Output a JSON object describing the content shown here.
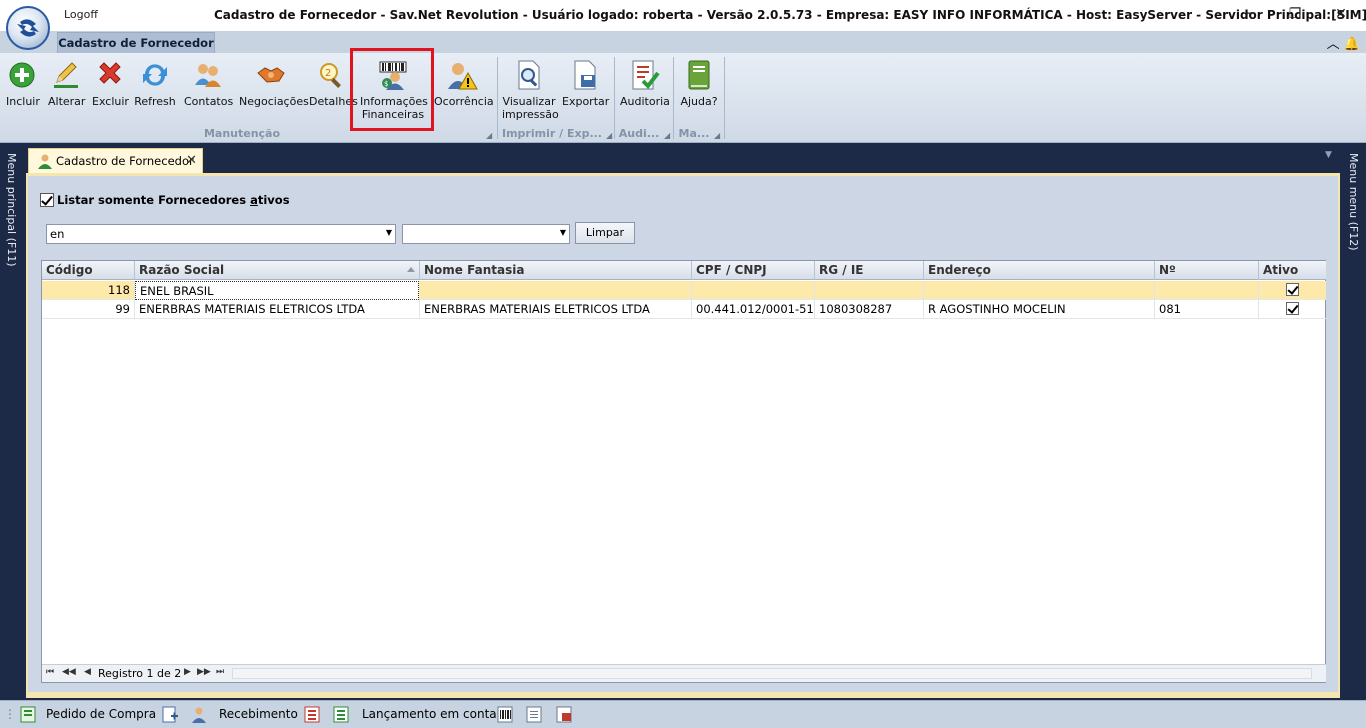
{
  "app": {
    "window_title": "Cadastro de Fornecedor - Sav.Net Revolution - Usuário logado: roberta - Versão 2.0.5.73 - Empresa: EASY INFO INFORMÁTICA - Host: EasyServer - Servidor Principal:[SIM]",
    "logoff_label": "Logoff",
    "window_controls": {
      "minimize": "─",
      "maximize": "❐",
      "close": "✕"
    }
  },
  "ribbon": {
    "tab_label": "Cadastro de Fornecedor",
    "buttons": {
      "incluir": "Incluir",
      "alterar": "Alterar",
      "excluir": "Excluir",
      "refresh": "Refresh",
      "contatos": "Contatos",
      "negociacoes": "Negociações",
      "detalhes": "Detalhes",
      "info_fin_line1": "Informações",
      "info_fin_line2": "Financeiras",
      "ocorrencia": "Ocorrência",
      "visualizar_line1": "Visualizar",
      "visualizar_line2": "impressão",
      "exportar": "Exportar",
      "auditoria": "Auditoria",
      "ajuda": "Ajuda?"
    },
    "groups": {
      "manutencao": "Manutenção",
      "imprimir": "Imprimir / Exp...",
      "auditoria": "Audi...",
      "ajuda": "Ma..."
    }
  },
  "side": {
    "left_label": "Menu principal (F11)",
    "right_label": "Menu menu (F12)"
  },
  "document_tab": {
    "label": "Cadastro de Fornecedor",
    "close": "✕"
  },
  "filters": {
    "active_only_prefix": "Listar somente Fornecedores ",
    "active_only_underlined": "a",
    "active_only_suffix": "tivos",
    "search_value": "en",
    "second_combo_value": "",
    "clear_button": "Limpar"
  },
  "grid": {
    "columns": [
      "Código",
      "Razão Social",
      "Nome Fantasia",
      "CPF / CNPJ",
      "RG / IE",
      "Endereço",
      "Nº",
      "Ativo"
    ],
    "rows": [
      {
        "codigo": "118",
        "razao": "ENEL BRASIL",
        "fantasia": "",
        "cnpj": "",
        "rg": "",
        "endereco": "",
        "numero": "",
        "ativo": true
      },
      {
        "codigo": "99",
        "razao": "ENERBRAS MATERIAIS ELETRICOS LTDA",
        "fantasia": "ENERBRAS MATERIAIS ELETRICOS LTDA",
        "cnpj": "00.441.012/0001-51",
        "rg": "1080308287",
        "endereco": "R AGOSTINHO MOCELIN",
        "numero": "081",
        "ativo": true
      }
    ],
    "navigator_text": "Registro 1 de 2"
  },
  "statusbar": {
    "pedido": "Pedido de Compra",
    "recebimento": "Recebimento",
    "lancamento": "Lançamento em conta"
  },
  "colors": {
    "highlight": "#e0141e",
    "selected_row": "#fde9a9",
    "frame": "#1c2a47"
  }
}
